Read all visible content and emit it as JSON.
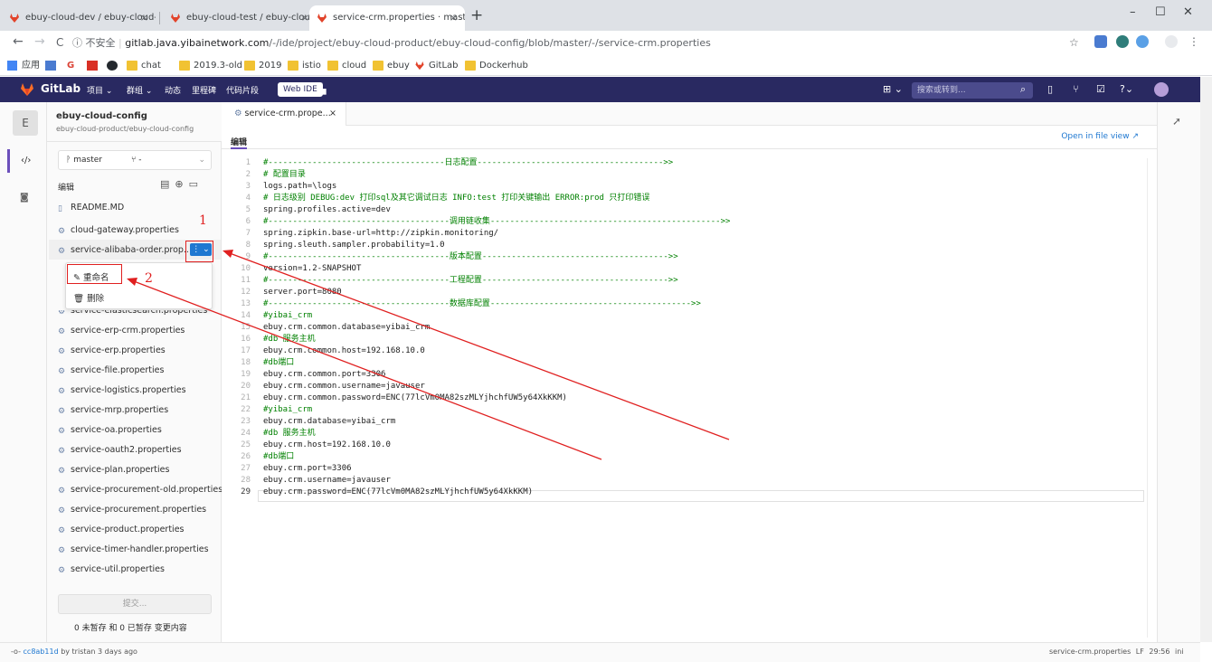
{
  "browser": {
    "tabs": [
      {
        "title": "ebuy-cloud-dev / ebuy-cloud-",
        "active": false
      },
      {
        "title": "ebuy-cloud-test / ebuy-cloud-",
        "active": false
      },
      {
        "title": "service-crm.properties · maste",
        "active": true
      }
    ],
    "new_tab": "+",
    "tab_close": "×",
    "window_controls": [
      "–",
      "☐",
      "✕"
    ],
    "nav": {
      "back": "←",
      "forward": "→",
      "reload": "C"
    },
    "url_security": "ⓘ 不安全",
    "url_host": "gitlab.java.yibainetwork.com",
    "url_path": "/-/ide/project/ebuy-cloud-product/ebuy-cloud-config/blob/master/-/service-crm.properties",
    "bookmarks": [
      "应用",
      "",
      "G",
      "",
      "",
      "chat",
      "2019.3-old",
      "2019",
      "istio",
      "cloud",
      "ebuy",
      "GitLab",
      "Dockerhub"
    ]
  },
  "gitlab": {
    "brand": "GitLab",
    "nav": [
      "项目 ⌄",
      "群组 ⌄",
      "动态",
      "里程碑",
      "代码片段"
    ],
    "web_ide": "Web IDE",
    "search_placeholder": "搜索或转到...",
    "accent": "#292961"
  },
  "project": {
    "avatar_letter": "E",
    "name": "ebuy-cloud-config",
    "path": "ebuy-cloud-product/ebuy-cloud-config"
  },
  "tree": {
    "branch": "master",
    "mr_label": "-",
    "header": "编辑",
    "files": [
      "README.MD",
      "cloud-gateway.properties",
      "service-alibaba-order.prop...",
      "service-elasticsearch.properties",
      "service-erp-crm.properties",
      "service-erp.properties",
      "service-file.properties",
      "service-logistics.properties",
      "service-mrp.properties",
      "service-oa.properties",
      "service-oauth2.properties",
      "service-plan.properties",
      "service-procurement-old.properties",
      "service-procurement.properties",
      "service-product.properties",
      "service-timer-handler.properties",
      "service-util.properties"
    ],
    "context_menu": [
      "重命名",
      "删除"
    ],
    "commit_button": "提交...",
    "commit_note": "0 未暂存 和 0 已暂存 变更内容"
  },
  "editor": {
    "tab_title": "service-crm.prope...",
    "mode_label": "编辑",
    "open_in_file_view": "Open in file view ↗",
    "lines": [
      "#------------------------------------日志配置-------------------------------------->>",
      "# 配置目录",
      "logs.path=\\logs",
      "# 日志级别 DEBUG:dev 打印sql及其它调试日志 INFO:test 打印关键输出 ERROR:prod 只打印错误",
      "spring.profiles.active=dev",
      "#-------------------------------------调用链收集----------------------------------------------->>",
      "spring.zipkin.base-url=http://zipkin.monitoring/",
      "spring.sleuth.sampler.probability=1.0",
      "#-------------------------------------版本配置-------------------------------------->>",
      "version=1.2-SNAPSHOT",
      "#-------------------------------------工程配置-------------------------------------->>",
      "server.port=8080",
      "#-------------------------------------数据库配置----------------------------------------->>",
      "#yibai_crm",
      "ebuy.crm.common.database=yibai_crm",
      "#db 服务主机",
      "ebuy.crm.common.host=192.168.10.0",
      "#db端口",
      "ebuy.crm.common.port=3306",
      "ebuy.crm.common.username=javauser",
      "ebuy.crm.common.password=ENC(77lcVm0MA82szMLYjhchfUW5y64XkKKM)",
      "#yibai_crm",
      "ebuy.crm.database=yibai_crm",
      "#db 服务主机",
      "ebuy.crm.host=192.168.10.0",
      "#db端口",
      "ebuy.crm.port=3306",
      "ebuy.crm.username=javauser",
      "ebuy.crm.password=ENC(77lcVm0MA82szMLYjhchfUW5y64XkKKM)"
    ]
  },
  "statusbar": {
    "commit_hash": "cc8ab11d",
    "commit_info": "by tristan 3 days ago",
    "right": "service-crm.properties  LF  29:56  ini"
  },
  "annotations": {
    "num1": "1",
    "num2": "2",
    "color": "#e02020"
  }
}
